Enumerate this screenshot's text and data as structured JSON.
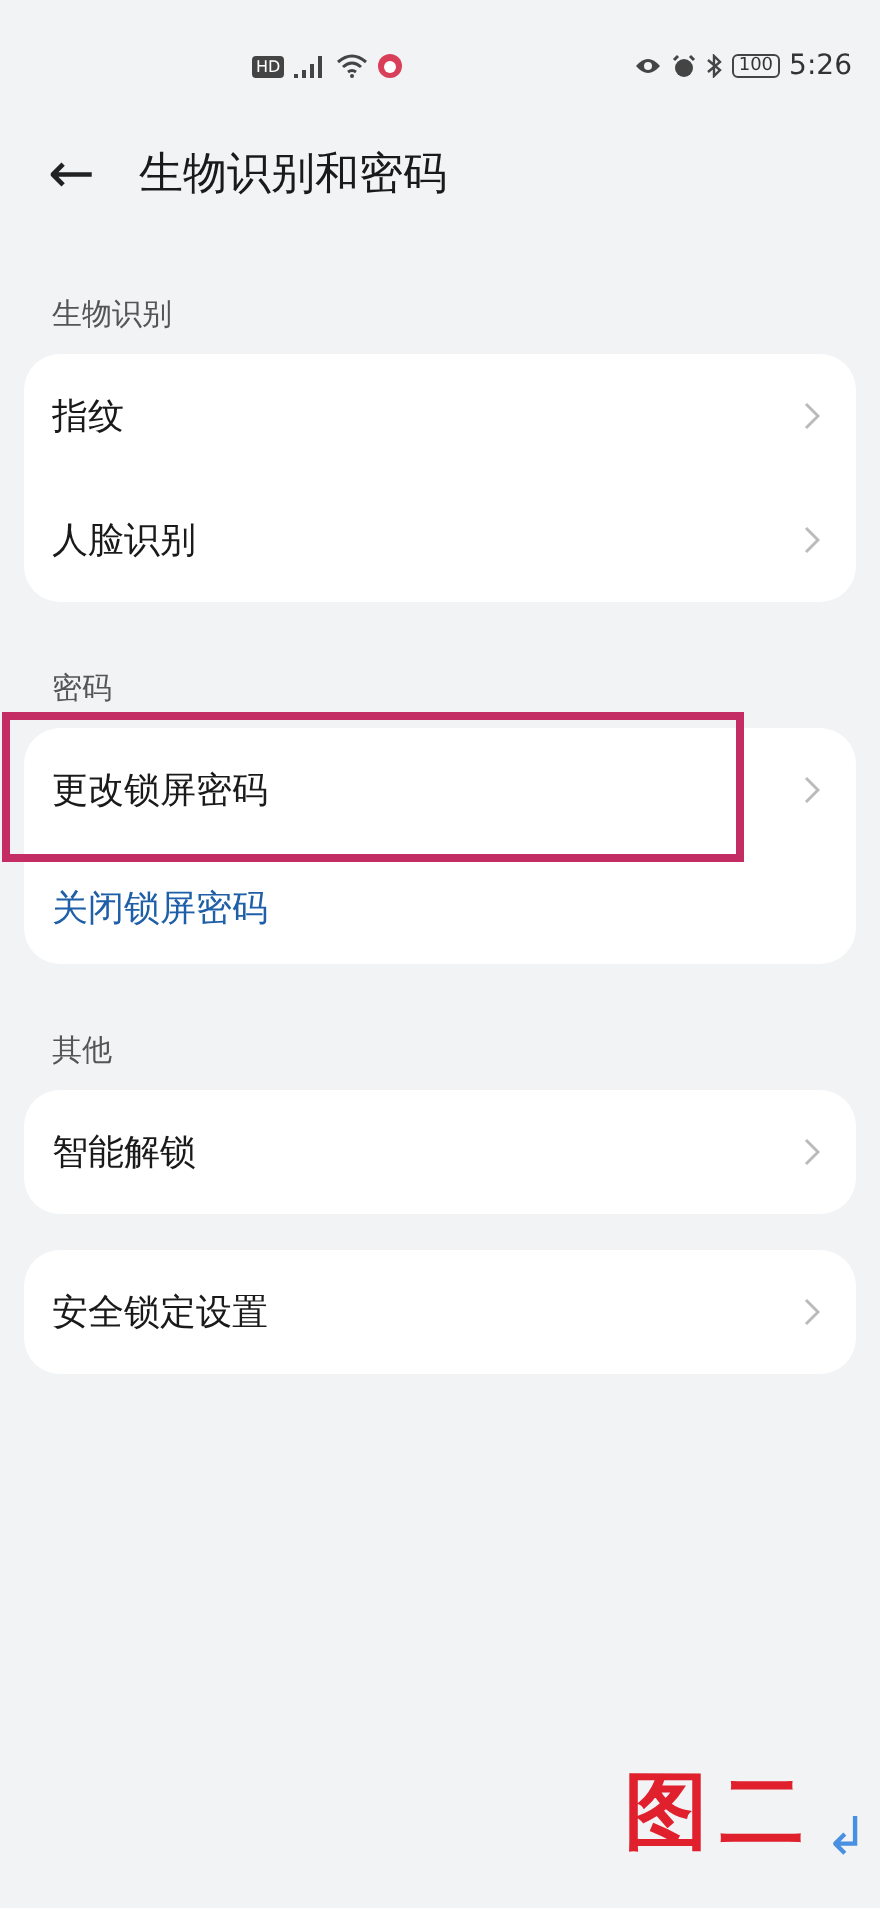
{
  "status_bar": {
    "hd_badge": "HD",
    "battery": "100",
    "time": "5:26"
  },
  "header": {
    "back": "←",
    "title": "生物识别和密码"
  },
  "sections": [
    {
      "label": "生物识别",
      "cards": [
        [
          {
            "kind": "nav",
            "label": "指纹",
            "highlighted": false
          },
          {
            "kind": "nav",
            "label": "人脸识别",
            "highlighted": false
          }
        ]
      ]
    },
    {
      "label": "密码",
      "cards": [
        [
          {
            "kind": "nav",
            "label": "更改锁屏密码",
            "highlighted": true
          },
          {
            "kind": "link",
            "label": "关闭锁屏密码"
          }
        ]
      ]
    },
    {
      "label": "其他",
      "cards": [
        [
          {
            "kind": "nav",
            "label": "智能解锁",
            "highlighted": false
          }
        ],
        [
          {
            "kind": "nav",
            "label": "安全锁定设置",
            "highlighted": false
          }
        ]
      ]
    }
  ],
  "caption": {
    "text": "图二",
    "mark": "↲"
  }
}
